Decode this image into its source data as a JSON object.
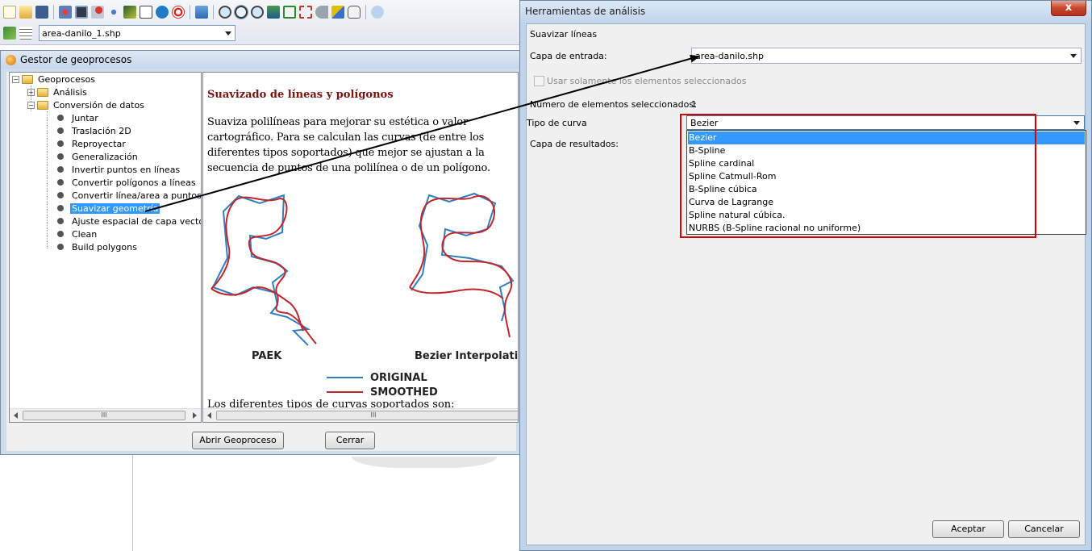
{
  "app": {
    "layer_selector_value": "area-danilo_1.shp"
  },
  "geoprocess_manager": {
    "title": "Gestor de geoprocesos",
    "tree": {
      "root": "Geoprocesos",
      "analysis": "Análisis",
      "conversion": "Conversión de datos",
      "items": [
        "Juntar",
        "Traslación 2D",
        "Reproyectar",
        "Generalización",
        "Invertir puntos en líneas",
        "Convertir polígonos a líneas",
        "Convertir línea/area a puntos",
        "Suavizar geometría",
        "Ajuste espacial de capa vectorial",
        "Clean",
        "Build polygons"
      ],
      "selected_item": "Suavizar geometría"
    },
    "help": {
      "title": "Suavizado de líneas y polígonos",
      "paragraph": "Suaviza polilíneas para mejorar su estética o valor cartográfico. Para se calculan las curvas (de entre los diferentes tipos soportados) que mejor se ajustan a la secuencia de puntos de una polilínea o de un polígono.",
      "figure": {
        "label_left": "PAEK",
        "label_right": "Bezier Interpolati",
        "legend_original": "ORIGINAL",
        "legend_smoothed": "SMOOTHED",
        "color_original": "#2f7fc1",
        "color_smoothed": "#c0262d"
      },
      "bottom_text": "Los diferentes tipos de curvas soportados son:"
    },
    "scroll_thumb": "III",
    "buttons": {
      "open": "Abrir Geoproceso",
      "close": "Cerrar"
    }
  },
  "analysis_dialog": {
    "title": "Herramientas de análisis",
    "close_glyph": "x",
    "section_title": "Suavizar líneas",
    "input_layer_label": "Capa de entrada:",
    "input_layer_value": "area-danilo.shp",
    "only_selected_label": "Usar solamente los elementos seleccionados",
    "selected_count_label": "Número de elementos seleccionados:",
    "selected_count_value": "1",
    "curve_type_label": "Tipo de curva",
    "curve_type_value": "Bezier",
    "output_layer_label": "Capa de resultados:",
    "curve_options": [
      "Bezier",
      "B-Spline",
      "Spline cardinal",
      "Spline Catmull-Rom",
      "B-Spline cúbica",
      "Curva de Lagrange",
      "Spline natural cúbica.",
      "NURBS (B-Spline racional no uniforme)"
    ],
    "buttons": {
      "accept": "Aceptar",
      "cancel": "Cancelar"
    },
    "highlight_color": "#d90000"
  }
}
